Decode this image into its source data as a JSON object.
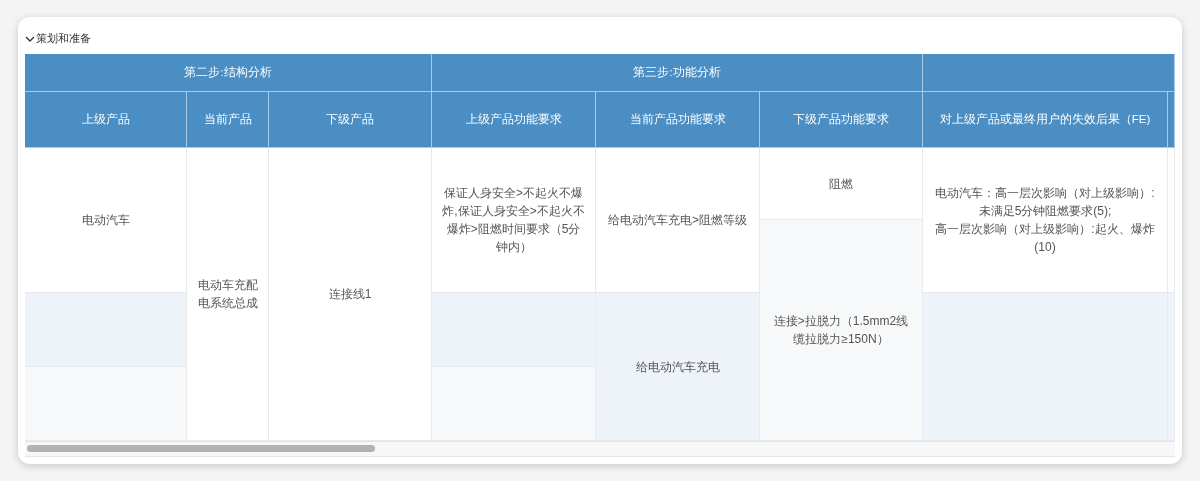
{
  "section": {
    "title": "策划和准备",
    "expanded": true
  },
  "table": {
    "groups": [
      "第二步:结构分析",
      "第三步:功能分析"
    ],
    "columns": [
      {
        "header": "上级产品",
        "cells": [
          "电动汽车"
        ]
      },
      {
        "header": "当前产品",
        "cells": [
          "电动车充配电系统总成"
        ]
      },
      {
        "header": "下级产品",
        "cells": [
          "连接线1"
        ]
      },
      {
        "header": "上级产品功能要求",
        "cells": [
          "保证人身安全>不起火不爆炸,保证人身安全>不起火不爆炸>阻燃时间要求（5分钟内）"
        ]
      },
      {
        "header": "当前产品功能要求",
        "cells": [
          "给电动汽车充电>阻燃等级",
          "给电动汽车充电"
        ]
      },
      {
        "header": "下级产品功能要求",
        "cells": [
          "阻燃",
          "连接>拉脱力（1.5mm2线缆拉脱力≥150N）"
        ]
      },
      {
        "header": "对上级产品或最终用户的失效后果（FE)",
        "cells": [
          "电动汽车：高一层次影响（对上级影响）:未满足5分钟阻燃要求(5);\n高一层次影响（对上级影响）:起火、爆炸(10)"
        ]
      }
    ]
  }
}
